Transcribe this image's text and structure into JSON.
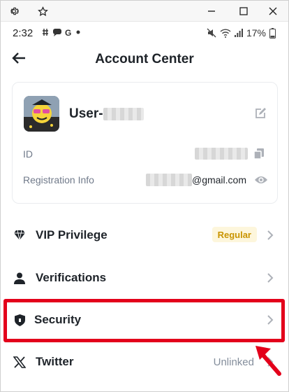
{
  "status_bar": {
    "time": "2:32",
    "battery": "17%"
  },
  "header": {
    "title": "Account Center"
  },
  "account": {
    "username_prefix": "User-",
    "id_label": "ID",
    "registration_label": "Registration Info",
    "email_domain": "@gmail.com"
  },
  "menu": {
    "vip_label": "VIP Privilege",
    "vip_badge": "Regular",
    "verifications_label": "Verifications",
    "security_label": "Security",
    "twitter_label": "Twitter",
    "twitter_status": "Unlinked"
  },
  "colors": {
    "highlight": "#e3001b",
    "badge_text": "#c99400",
    "badge_bg": "#fdf6dc"
  },
  "icons": {
    "chrome": [
      "gear-icon",
      "star-icon",
      "minimize-icon",
      "maximize-icon",
      "close-icon"
    ],
    "menu": [
      "diamond-icon",
      "user-icon",
      "shield-icon",
      "x-logo-icon"
    ]
  }
}
